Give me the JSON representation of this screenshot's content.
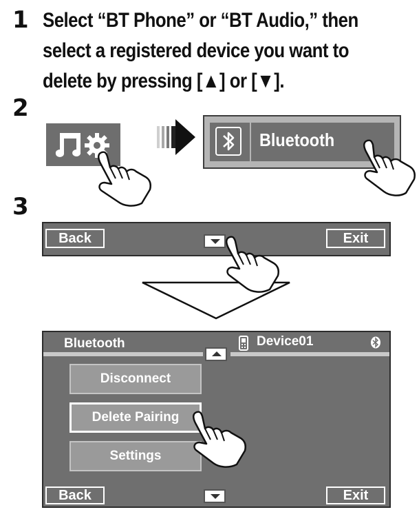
{
  "steps": {
    "step1": {
      "number": "1",
      "lines": [
        "Select “BT Phone” or “BT Audio,” then",
        "select a registered device you want to",
        "delete by pressing [▲] or [▼]."
      ]
    },
    "step2": {
      "number": "2",
      "bt_label": "Bluetooth"
    },
    "step3": {
      "number": "3",
      "bar": {
        "back": "Back",
        "exit": "Exit"
      },
      "screen": {
        "title": "Bluetooth",
        "device": "Device01",
        "menu": [
          "Disconnect",
          "Delete Pairing",
          "Settings"
        ],
        "back": "Back",
        "exit": "Exit"
      }
    }
  },
  "icons": [
    "music-settings-icon",
    "arrow-right-icon",
    "bluetooth-icon",
    "pointing-hand-icon",
    "down-arrow-icon",
    "up-arrow-icon",
    "phone-icon"
  ],
  "colors": {
    "panel": "#6f6f6f",
    "panel_border": "#2c2c2c",
    "light_bar": "#c9c9c9"
  }
}
